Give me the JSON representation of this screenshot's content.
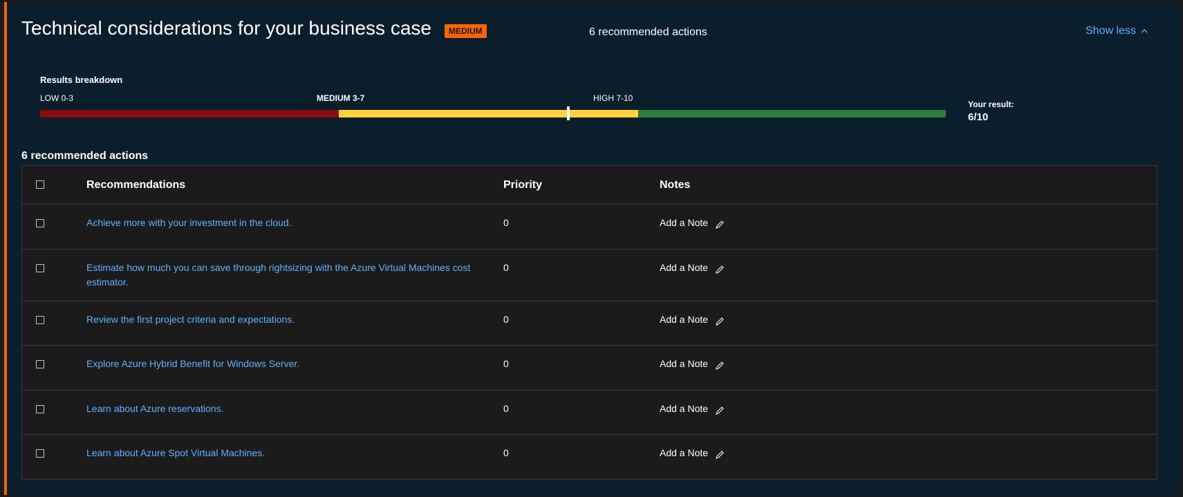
{
  "header": {
    "title": "Technical considerations for your business case",
    "badge": "MEDIUM",
    "recommended_count": "6 recommended actions",
    "show_less": "Show less",
    "accent_color": "#f7630c"
  },
  "breakdown": {
    "title": "Results breakdown",
    "low_label": "LOW 0-3",
    "medium_label": "MEDIUM 3-7",
    "high_label": "HIGH 7-10",
    "colors": {
      "low": "#8a0d0d",
      "medium": "#ffd23f",
      "high": "#2e7d3a"
    },
    "result_label": "Your result:",
    "result_value": "6/10",
    "result_score": 6,
    "score_max": 10
  },
  "table": {
    "caption": "6 recommended actions",
    "headers": {
      "recommendations": "Recommendations",
      "priority": "Priority",
      "notes": "Notes"
    },
    "rows": [
      {
        "recommendation": "Achieve more with your investment in the cloud.",
        "priority": "0",
        "note": "Add a Note"
      },
      {
        "recommendation": "Estimate how much you can save through rightsizing with the Azure Virtual Machines cost estimator.",
        "priority": "0",
        "note": "Add a Note"
      },
      {
        "recommendation": "Review the first project criteria and expectations.",
        "priority": "0",
        "note": "Add a Note"
      },
      {
        "recommendation": "Explore Azure Hybrid Benefit for Windows Server.",
        "priority": "0",
        "note": "Add a Note"
      },
      {
        "recommendation": "Learn about Azure reservations.",
        "priority": "0",
        "note": "Add a Note"
      },
      {
        "recommendation": "Learn about Azure Spot Virtual Machines.",
        "priority": "0",
        "note": "Add a Note"
      }
    ],
    "link_color": "#62b0ff"
  },
  "icons": {
    "show_less": "chevron-up-icon",
    "note": "pencil-icon"
  }
}
